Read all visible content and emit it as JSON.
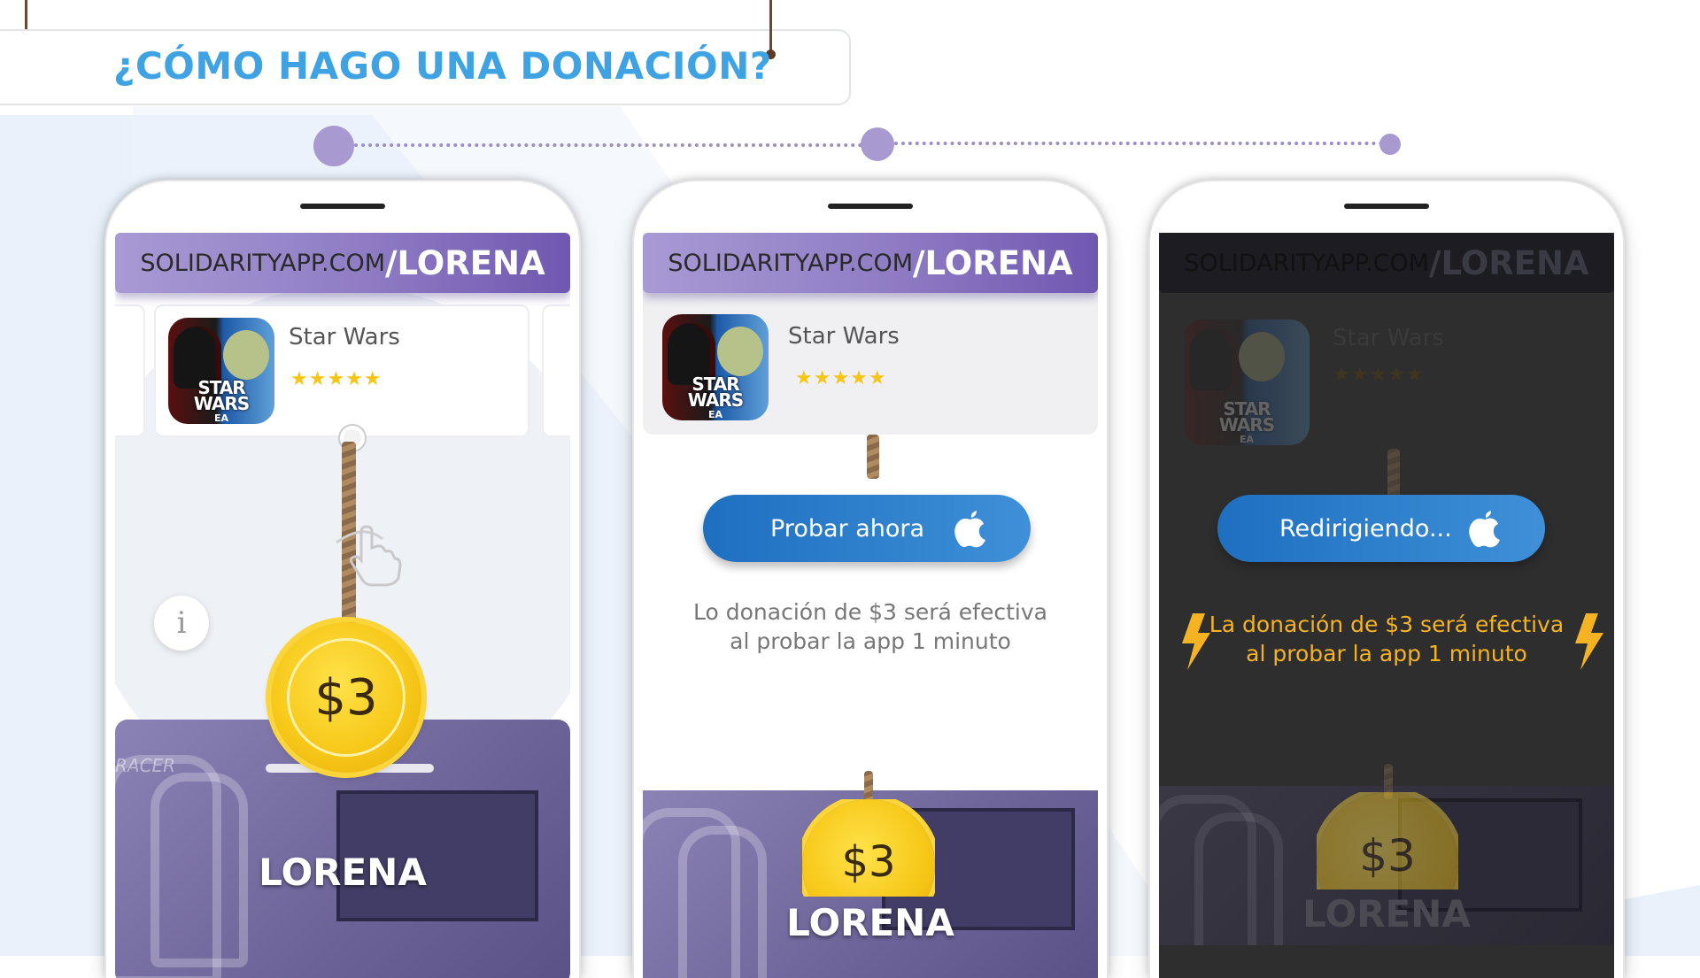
{
  "page": {
    "title": "¿CÓMO HAGO UNA DONACIÓN?",
    "accent_color": "#3ea2e3",
    "step_color": "#a899d0"
  },
  "steps": [
    {
      "url_base": "SOLIDARITYAPP.COM",
      "url_sep": "/",
      "url_slug": "LORENA",
      "app_name": "Star Wars",
      "stars": "★★★★★",
      "icon_text_1": "STAR",
      "icon_text_2": "WARS",
      "icon_text_ea": "EA",
      "info_label": "i",
      "hand_icon": "hand-pointer-icon",
      "coin_label": "$3",
      "banner_name": "LORENA",
      "banner_brand": "RACER"
    },
    {
      "url_base": "SOLIDARITYAPP.COM",
      "url_sep": "/",
      "url_slug": "LORENA",
      "app_name": "Star Wars",
      "stars": "★★★★★",
      "icon_text_1": "STAR",
      "icon_text_2": "WARS",
      "icon_text_ea": "EA",
      "cta_label": "Probar ahora",
      "cta_icon": "apple-icon",
      "note_line1": "Lo donación de $3 será efectiva",
      "note_line2": "al probar la app 1 minuto",
      "coin_label": "$3",
      "banner_name": "LORENA"
    },
    {
      "url_base": "SOLIDARITYAPP.COM",
      "url_sep": "/",
      "url_slug": "LORENA",
      "app_name": "Star Wars",
      "stars": "★★★★★",
      "icon_text_1": "STAR",
      "icon_text_2": "WARS",
      "icon_text_ea": "EA",
      "cta_label": "Redirigiendo...",
      "cta_icon": "apple-icon",
      "note_line1": "La donación de $3 será efectiva",
      "note_line2": "al probar la app 1 minuto",
      "note_color": "#f5b324",
      "coin_label": "$3",
      "banner_name": "LORENA"
    }
  ]
}
